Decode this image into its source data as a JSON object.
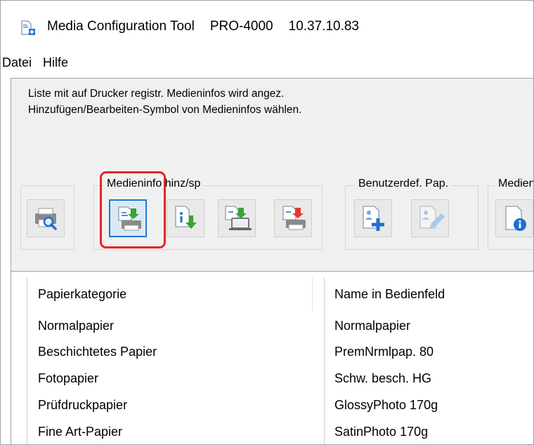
{
  "window": {
    "app_name": "Media Configuration Tool",
    "printer_model": "PRO-4000",
    "ip_address": "10.37.10.83"
  },
  "menu": [
    "Datei",
    "Hilfe"
  ],
  "instructions": {
    "line1": "Liste mit auf Drucker registr. Medieninfos wird angez.",
    "line2": "Hinzufügen/Bearbeiten-Symbol von Medieninfos wählen."
  },
  "toolbar": {
    "group_media_add": "Medieninfo hinz/sp",
    "group_custom_paper": "Benutzerdef. Pap.",
    "group_media_info": "Medien"
  },
  "table": {
    "headers": [
      "Papierkategorie",
      "Name in Bedienfeld"
    ],
    "rows": [
      [
        "Normalpapier",
        "Normalpapier"
      ],
      [
        "Beschichtetes Papier",
        "PremNrmlpap. 80"
      ],
      [
        "Fotopapier",
        "Schw. besch. HG"
      ],
      [
        "Prüfdruckpapier",
        "GlossyPhoto 170g"
      ],
      [
        "Fine Art-Papier",
        "SatinPhoto 170g"
      ]
    ]
  },
  "colors": {
    "highlight": "#e8222a",
    "selected_border": "#1f77d0",
    "arrow_green": "#3aa335",
    "arrow_red": "#e53935",
    "accent_blue": "#1e6fd0"
  }
}
